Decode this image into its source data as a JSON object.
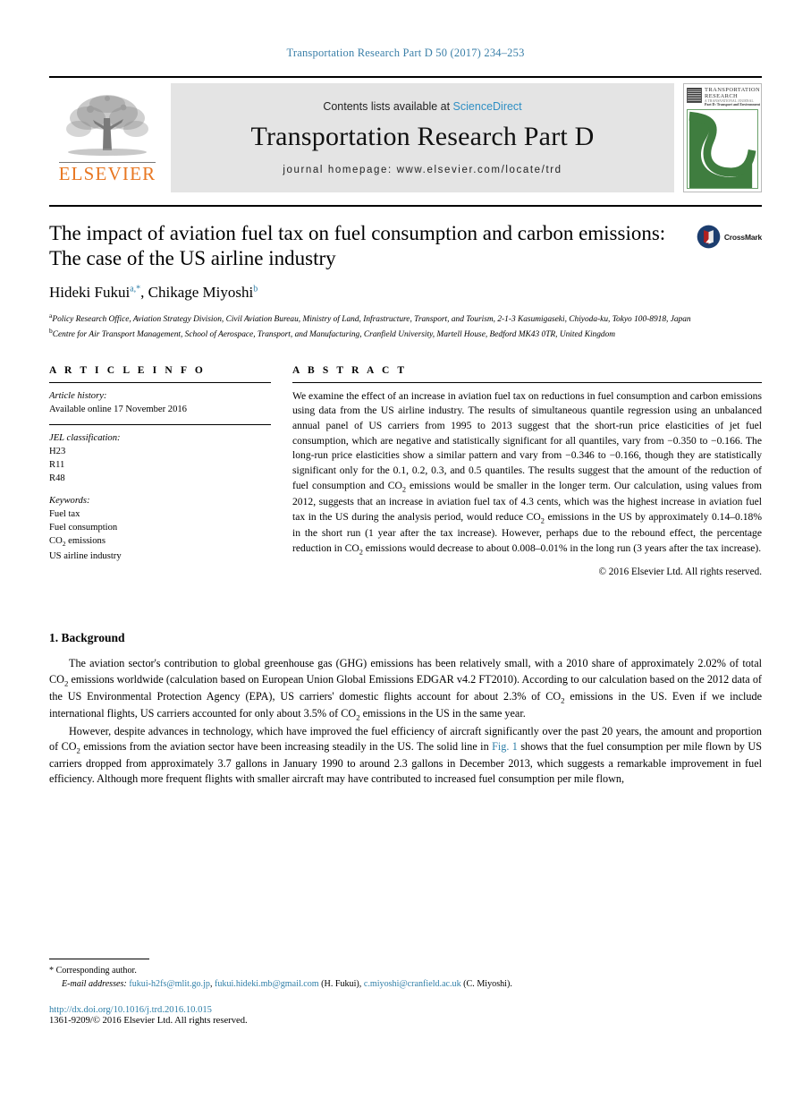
{
  "running_head": "Transportation Research Part D 50 (2017) 234–253",
  "masthead": {
    "publisher_name": "ELSEVIER",
    "contents_prefix": "Contents lists available at ",
    "contents_link": "ScienceDirect",
    "journal_title": "Transportation Research Part D",
    "homepage": "journal homepage: www.elsevier.com/locate/trd",
    "cover": {
      "line1": "TRANSPORTATION",
      "line2": "RESEARCH",
      "line3": "A TRANSNATIONAL JOURNAL",
      "line4": "Part D: Transport and Environment"
    }
  },
  "article": {
    "title": "The impact of aviation fuel tax on fuel consumption and carbon emissions: The case of the US airline industry",
    "crossmark_label": "CrossMark",
    "authors": [
      {
        "name": "Hideki Fukui",
        "marks": "a,*"
      },
      {
        "name": "Chikage Miyoshi",
        "marks": "b"
      }
    ],
    "affiliations": [
      {
        "mark": "a",
        "text": "Policy Research Office, Aviation Strategy Division, Civil Aviation Bureau, Ministry of Land, Infrastructure, Transport, and Tourism, 2-1-3 Kasumigaseki, Chiyoda-ku, Tokyo 100-8918, Japan"
      },
      {
        "mark": "b",
        "text": "Centre for Air Transport Management, School of Aerospace, Transport, and Manufacturing, Cranfield University, Martell House, Bedford MK43 0TR, United Kingdom"
      }
    ]
  },
  "article_info": {
    "heading": "A R T I C L E   I N F O",
    "history_label": "Article history:",
    "history_value": "Available online 17 November 2016",
    "jel_label": "JEL classification:",
    "jel_codes": [
      "H23",
      "R11",
      "R48"
    ],
    "keywords_label": "Keywords:",
    "keywords": [
      "Fuel tax",
      "Fuel consumption",
      "CO2 emissions",
      "US airline industry"
    ]
  },
  "abstract": {
    "heading": "A B S T R A C T",
    "text": "We examine the effect of an increase in aviation fuel tax on reductions in fuel consumption and carbon emissions using data from the US airline industry. The results of simultaneous quantile regression using an unbalanced annual panel of US carriers from 1995 to 2013 suggest that the short-run price elasticities of jet fuel consumption, which are negative and statistically significant for all quantiles, vary from −0.350 to −0.166. The long-run price elasticities show a similar pattern and vary from −0.346 to −0.166, though they are statistically significant only for the 0.1, 0.2, 0.3, and 0.5 quantiles. The results suggest that the amount of the reduction of fuel consumption and CO2 emissions would be smaller in the longer term. Our calculation, using values from 2012, suggests that an increase in aviation fuel tax of 4.3 cents, which was the highest increase in aviation fuel tax in the US during the analysis period, would reduce CO2 emissions in the US by approximately 0.14–0.18% in the short run (1 year after the tax increase). However, perhaps due to the rebound effect, the percentage reduction in CO2 emissions would decrease to about 0.008–0.01% in the long run (3 years after the tax increase).",
    "copyright": "© 2016 Elsevier Ltd. All rights reserved."
  },
  "body": {
    "section_heading": "1. Background",
    "paragraph1": "The aviation sector's contribution to global greenhouse gas (GHG) emissions has been relatively small, with a 2010 share of approximately 2.02% of total CO2 emissions worldwide (calculation based on European Union Global Emissions EDGAR v4.2 FT2010). According to our calculation based on the 2012 data of the US Environmental Protection Agency (EPA), US carriers' domestic flights account for about 2.3% of CO2 emissions in the US. Even if we include international flights, US carriers accounted for only about 3.5% of CO2 emissions in the US in the same year.",
    "paragraph2_a": "However, despite advances in technology, which have improved the fuel efficiency of aircraft significantly over the past 20 years, the amount and proportion of CO2 emissions from the aviation sector have been increasing steadily in the US. The solid line in ",
    "paragraph2_link": "Fig. 1",
    "paragraph2_b": " shows that the fuel consumption per mile flown by US carriers dropped from approximately 3.7 gallons in January 1990 to around 2.3 gallons in December 2013, which suggests a remarkable improvement in fuel efficiency. Although more frequent flights with smaller aircraft may have contributed to increased fuel consumption per mile flown,"
  },
  "footer": {
    "corresponding_mark": "*",
    "corresponding_text": "Corresponding author.",
    "email_label": "E-mail addresses:",
    "email1": "fukui-h2fs@mlit.go.jp",
    "email_sep1": ", ",
    "email2": "fukui.hideki.mb@gmail.com",
    "author1_paren": " (H. Fukui), ",
    "email3": "c.miyoshi@cranfield.ac.uk",
    "author2_paren": " (C. Miyoshi).",
    "doi": "http://dx.doi.org/10.1016/j.trd.2016.10.015",
    "issn": "1361-9209/© 2016 Elsevier Ltd. All rights reserved."
  },
  "colors": {
    "link_blue": "#2f7fa8",
    "sciencedirect_blue": "#2f8fc4",
    "elsevier_orange": "#E87722",
    "cover_green": "#3f7d3f",
    "band_gray": "#e4e4e4"
  }
}
